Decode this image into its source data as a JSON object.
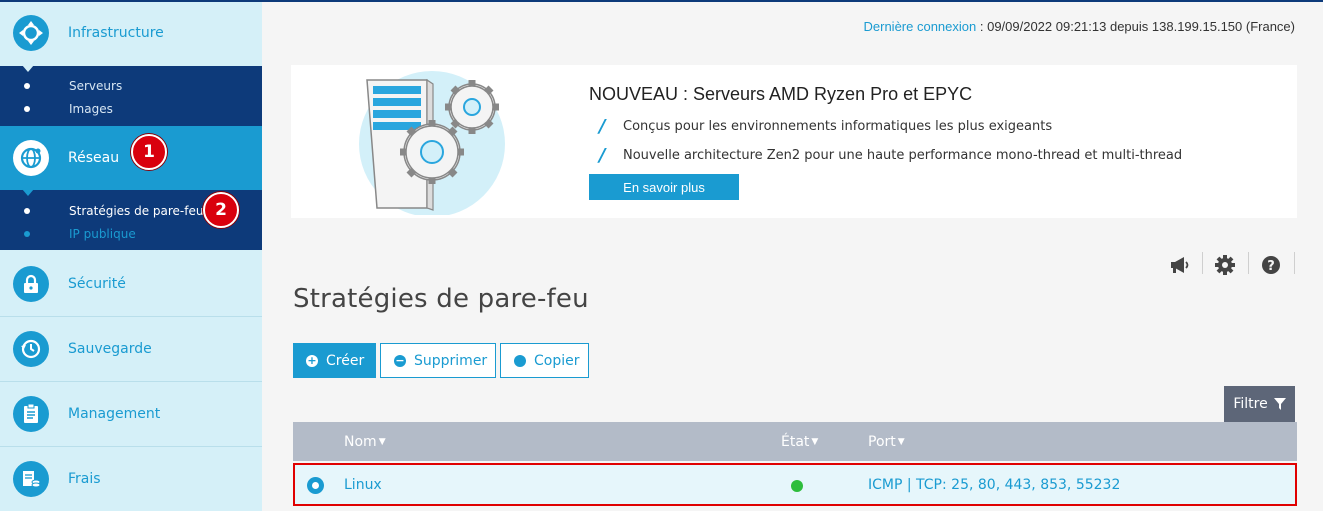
{
  "sidebar": {
    "items": [
      {
        "label": "Infrastructure",
        "icon": "infrastructure-icon"
      },
      {
        "label": "Réseau",
        "icon": "network-globe-icon"
      },
      {
        "label": "Sécurité",
        "icon": "lock-icon"
      },
      {
        "label": "Sauvegarde",
        "icon": "backup-clock-icon"
      },
      {
        "label": "Management",
        "icon": "clipboard-icon"
      },
      {
        "label": "Frais",
        "icon": "invoice-icon"
      }
    ],
    "infrastructure_sub": [
      "Serveurs",
      "Images"
    ],
    "reseau_sub": [
      "Stratégies de pare-feu",
      "IP publique"
    ]
  },
  "annotations": {
    "badge1": "1",
    "badge2": "2"
  },
  "header": {
    "last_login_label": "Dernière connexion",
    "last_login_value": ": 09/09/2022 09:21:13 depuis 138.199.15.150 (France)"
  },
  "promo": {
    "title": "NOUVEAU : Serveurs AMD Ryzen Pro et EPYC",
    "features": [
      "Conçus pour les environnements informatiques les plus exigeants",
      "Nouvelle architecture Zen2 pour une haute performance mono-thread et multi-thread"
    ],
    "button": "En savoir plus"
  },
  "page": {
    "title": "Stratégies de pare-feu"
  },
  "actions": {
    "create": "Créer",
    "delete": "Supprimer",
    "copy": "Copier",
    "filter": "Filtre"
  },
  "table": {
    "headers": {
      "name": "Nom",
      "state": "État",
      "port": "Port"
    },
    "rows": [
      {
        "name": "Linux",
        "state": "active",
        "port": "ICMP | TCP: 25, 80, 443, 853, 55232"
      }
    ]
  },
  "colors": {
    "accent": "#1a9bd1",
    "navy": "#0d3a7a",
    "sidebar_bg": "#d5f0f8",
    "status_ok": "#2ebd3c",
    "highlight": "#e00000"
  }
}
